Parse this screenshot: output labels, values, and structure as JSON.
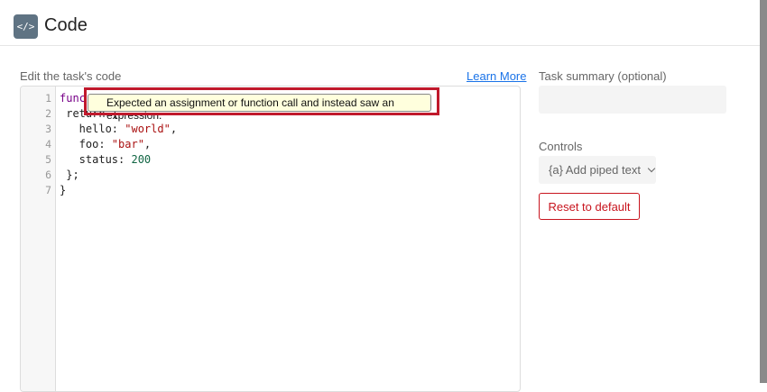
{
  "header": {
    "title": "Code",
    "icon": "code-icon",
    "icon_glyph": "</>"
  },
  "editor": {
    "label": "Edit the task's code",
    "learn_more": "Learn More",
    "lines": [
      {
        "n": "1",
        "text": "func"
      },
      {
        "n": "2",
        "text": " return {"
      },
      {
        "n": "3",
        "key": "   hello: ",
        "val": "\"world\"",
        "tail": ","
      },
      {
        "n": "4",
        "key": "   foo: ",
        "val": "\"bar\"",
        "tail": ","
      },
      {
        "n": "5",
        "key": "   status: ",
        "num": "200"
      },
      {
        "n": "6",
        "text": " };"
      },
      {
        "n": "7",
        "text": "}"
      }
    ],
    "tooltip": "Expected an assignment or function call and instead saw an expression."
  },
  "sidebar": {
    "summary_label": "Task summary (optional)",
    "summary_value": "",
    "controls_label": "Controls",
    "piped_text": "{a} Add piped text",
    "reset": "Reset to default"
  }
}
